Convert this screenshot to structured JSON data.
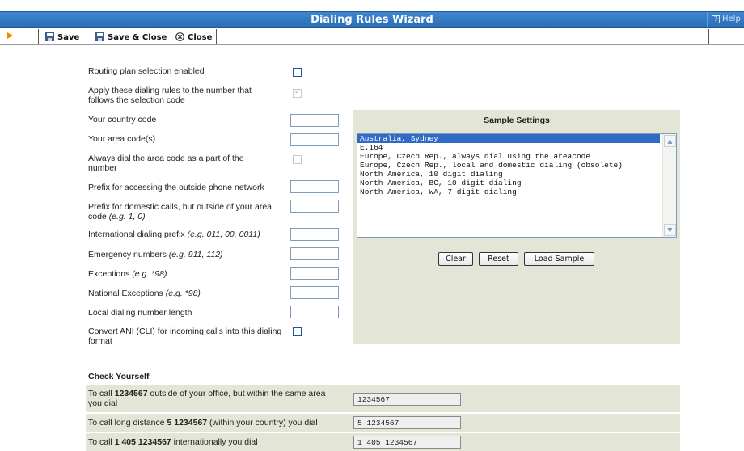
{
  "window": {
    "title": "Dialing Rules Wizard",
    "help_label": "Help"
  },
  "toolbar": {
    "save_label": "Save",
    "save_close_label": "Save & Close",
    "close_label": "Close"
  },
  "form": {
    "routing_plan": "Routing plan selection enabled",
    "apply_rules": "Apply these dialing rules to the number that follows the selection code",
    "country_code": "Your country code",
    "area_codes": "Your area code(s)",
    "always_dial_area": "Always dial the area code as a part of the number",
    "outside_prefix": "Prefix for accessing the outside phone network",
    "domestic_prefix": "Prefix for domestic calls, but outside of your area code",
    "domestic_prefix_example": "(e.g. 1, 0)",
    "intl_prefix": "International dialing prefix",
    "intl_prefix_example": "(e.g. 011, 00, 0011)",
    "emergency": "Emergency numbers",
    "emergency_example": "(e.g. 911, 112)",
    "exceptions": "Exceptions",
    "exceptions_example": "(e.g. *98)",
    "national_exceptions": "National Exceptions",
    "national_exceptions_example": "(e.g. *98)",
    "local_length": "Local dialing number length",
    "convert_ani": "Convert ANI (CLI) for incoming calls into this dialing format"
  },
  "sample": {
    "title": "Sample Settings",
    "options": [
      "Australia, Sydney",
      "E.164",
      "Europe, Czech Rep., always dial using the areacode",
      "Europe, Czech Rep., local and domestic dialing (obsolete)",
      "North America, 10 digit dialing",
      "North America, BC, 10 digit dialing",
      "North America, WA, 7 digit dialing"
    ],
    "clear_label": "Clear",
    "reset_label": "Reset",
    "load_label": "Load Sample"
  },
  "check": {
    "title": "Check Yourself",
    "row1_pre": "To call ",
    "row1_num": "1234567",
    "row1_post": " outside of your office, but within the same area you dial",
    "row1_value": "1234567",
    "row2_pre": "To call long distance ",
    "row2_num": "5 1234567",
    "row2_post": " (within your country) you dial",
    "row2_value": "5 1234567",
    "row3_pre": "To call ",
    "row3_num": "1 405 1234567",
    "row3_post": " internationally you dial",
    "row3_value": "1 405 1234567"
  },
  "colors": {
    "titlebar": "#2f76c0",
    "panel": "#e3e5d6",
    "selection": "#316ac5"
  }
}
